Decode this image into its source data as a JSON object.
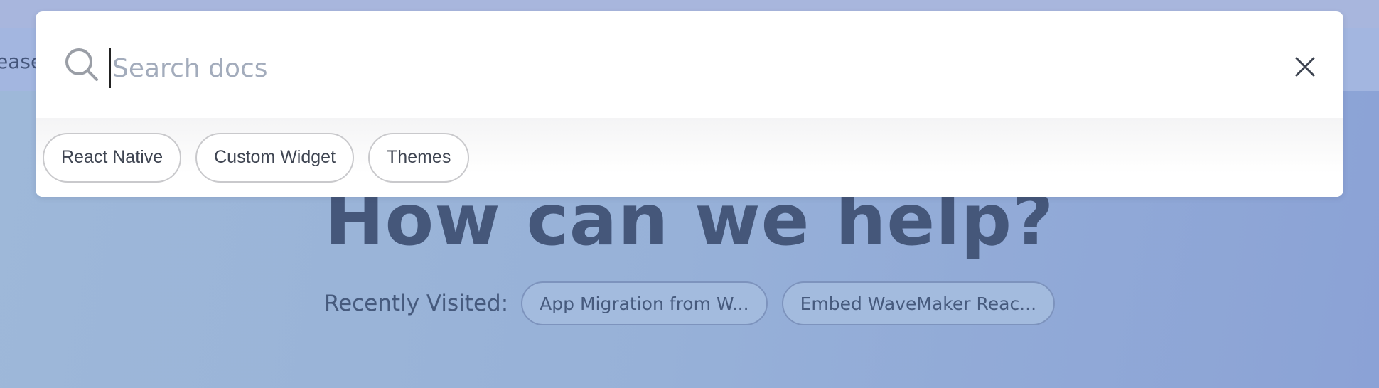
{
  "page": {
    "nav_fragment": "ease",
    "hero_title": "How can we help?",
    "recently_visited": {
      "label": "Recently Visited:",
      "items": [
        {
          "label": "App Migration from W..."
        },
        {
          "label": "Embed WaveMaker Reac..."
        }
      ]
    }
  },
  "search_modal": {
    "search": {
      "placeholder": "Search docs",
      "value": "",
      "icon": "search-icon"
    },
    "close_icon": "close-icon",
    "suggestions": [
      {
        "label": "React Native"
      },
      {
        "label": "Custom Widget"
      },
      {
        "label": "Themes"
      }
    ]
  },
  "colors": {
    "background": "#97b1d8",
    "hero_text": "#45577a",
    "modal_bg": "#ffffff",
    "placeholder": "#a3acbc"
  }
}
